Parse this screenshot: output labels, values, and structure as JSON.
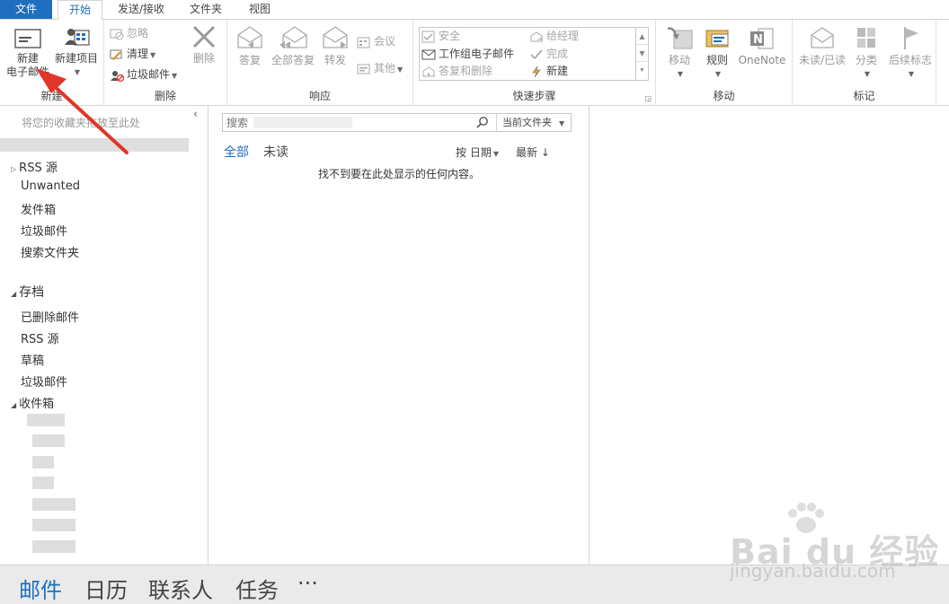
{
  "tabs": {
    "file": "文件",
    "home": "开始",
    "send_receive": "发送/接收",
    "folder": "文件夹",
    "view": "视图"
  },
  "ribbon": {
    "new_group": {
      "label": "新建",
      "new_email_line1": "新建",
      "new_email_line2": "电子邮件",
      "new_items": "新建项目"
    },
    "delete_group": {
      "label": "删除",
      "ignore": "忽略",
      "cleanup": "清理",
      "junk": "垃圾邮件",
      "delete": "删除"
    },
    "respond_group": {
      "label": "响应",
      "reply": "答复",
      "reply_all": "全部答复",
      "forward": "转发",
      "meeting": "会议",
      "more": "其他"
    },
    "quick_steps_group": {
      "label": "快速步骤",
      "items": [
        "安全",
        "给经理",
        "工作组电子邮件",
        "完成",
        "答复和删除",
        "新建"
      ]
    },
    "move_group": {
      "label": "移动",
      "move": "移动",
      "rules": "规则",
      "onenote": "OneNote"
    },
    "tags_group": {
      "label": "标记",
      "read_unread": "未读/已读",
      "categorize": "分类",
      "follow_up": "后续标志"
    }
  },
  "nav": {
    "favorites_hint": "将您的收藏夹拖放至此处",
    "items_top": [
      "RSS 源",
      "Unwanted",
      "发件箱",
      "垃圾邮件",
      "搜索文件夹"
    ],
    "archive_header": "存档",
    "archive_items": [
      "已删除邮件",
      "RSS 源",
      "草稿",
      "垃圾邮件"
    ],
    "inbox_header": "收件箱"
  },
  "list": {
    "search_placeholder": "搜索",
    "search_scope": "当前文件夹",
    "filter_all": "全部",
    "filter_unread": "未读",
    "sort_by": "按 日期",
    "sort_order": "最新 ↓",
    "empty_message": "找不到要在此处显示的任何内容。"
  },
  "bottom_nav": {
    "mail": "邮件",
    "calendar": "日历",
    "contacts": "联系人",
    "tasks": "任务",
    "more": "···"
  },
  "watermark": {
    "brand": "Bai du 经验",
    "url": "jingyan.baidu.com"
  },
  "colors": {
    "accent": "#1e6fbf",
    "annotation_arrow": "#e0352b"
  }
}
